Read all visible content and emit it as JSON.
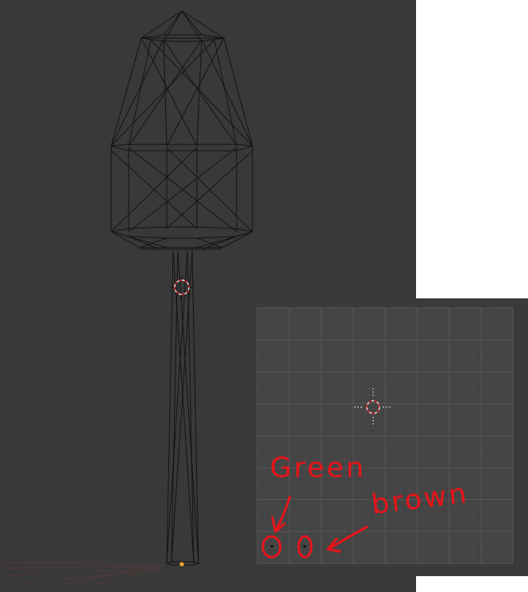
{
  "viewport_3d": {
    "background": "#393939",
    "wire_color": "#141414",
    "object": "tree-mesh-wireframe",
    "cursor_icon": "3d-cursor-icon",
    "origin_icon": "object-origin-dot-icon",
    "origin_color": "#f0a030"
  },
  "uv_editor": {
    "background": "#3a3a3a",
    "grid_color": "#4c4c4c",
    "grid_major_color": "#575757",
    "cursor_icon": "2d-cursor-icon",
    "uv_points": [
      {
        "name": "green-uv-point",
        "circled": true
      },
      {
        "name": "brown-uv-point",
        "circled": true
      }
    ]
  },
  "annotations": {
    "color": "#e8141a",
    "green_label": "Green",
    "brown_label": "brown"
  }
}
